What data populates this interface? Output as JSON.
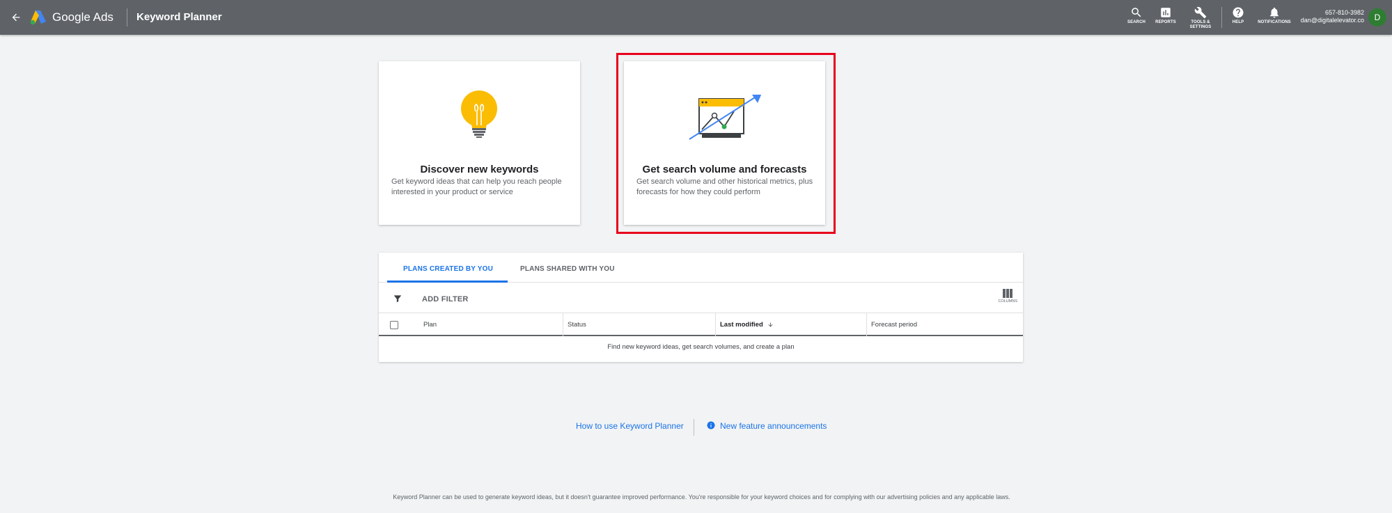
{
  "header": {
    "back_label": "Back",
    "brand": "Google Ads",
    "tool_name": "Keyword Planner",
    "actions": [
      {
        "label": "SEARCH",
        "icon": "search-icon"
      },
      {
        "label": "REPORTS",
        "icon": "reports-icon"
      },
      {
        "label": "TOOLS &\nSETTINGS",
        "icon": "wrench-icon"
      },
      {
        "label": "HELP",
        "icon": "help-icon"
      },
      {
        "label": "NOTIFICATIONS",
        "icon": "bell-icon"
      }
    ],
    "account": {
      "phone": "657-810-3982",
      "email": "dan@digitalelevator.co",
      "avatar_initial": "D"
    }
  },
  "cards": [
    {
      "title": "Discover new keywords",
      "description": "Get keyword ideas that can help you reach people interested in your product or service",
      "icon": "lightbulb-icon"
    },
    {
      "title": "Get search volume and forecasts",
      "description": "Get search volume and other historical metrics, plus forecasts for how they could perform",
      "icon": "forecast-chart-icon"
    }
  ],
  "plans": {
    "tabs": [
      {
        "label": "PLANS CREATED BY YOU",
        "active": true
      },
      {
        "label": "PLANS SHARED WITH YOU",
        "active": false
      }
    ],
    "add_filter": "ADD FILTER",
    "columns_label": "COLUMNS",
    "columns": [
      "Plan",
      "Status",
      "Last modified",
      "Forecast period"
    ],
    "empty_message": "Find new keyword ideas, get search volumes, and create a plan"
  },
  "links": {
    "how_to": "How to use Keyword Planner",
    "announcements": "New feature announcements"
  },
  "disclaimer": "Keyword Planner can be used to generate keyword ideas, but it doesn't guarantee improved performance. You're responsible for your keyword choices and for complying with our advertising policies and any applicable laws.",
  "colors": {
    "topbar": "#5f6368",
    "accent": "#1a73e8",
    "highlight": "#e8001c",
    "avatar": "#2e7d32",
    "bulb": "#fbbc04"
  }
}
